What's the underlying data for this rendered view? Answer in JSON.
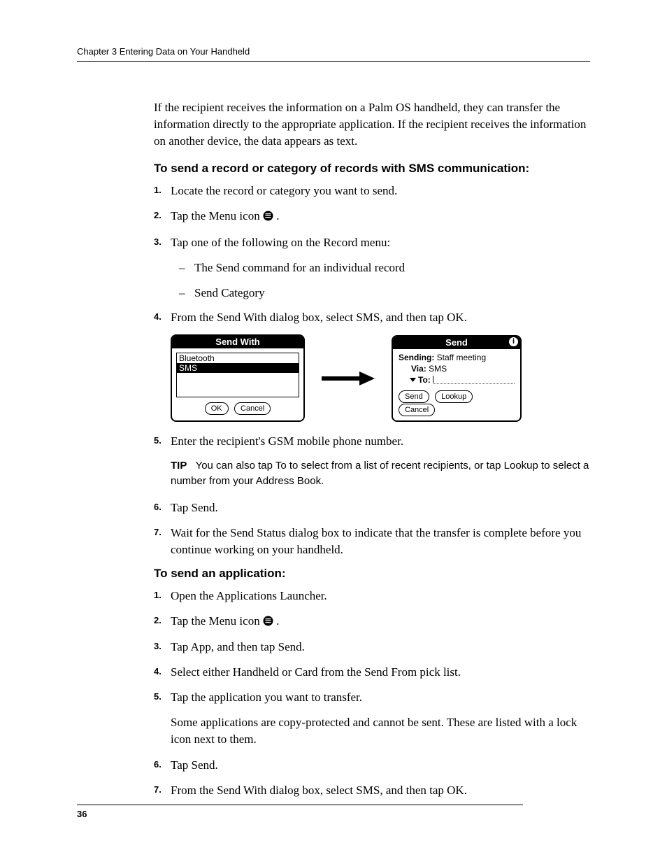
{
  "running_head": "Chapter 3   Entering Data on Your Handheld",
  "intro_para": "If the recipient receives the information on a Palm OS handheld, they can transfer the information directly to the appropriate application. If the recipient receives the information on another device, the data appears as text.",
  "section1_title": "To send a record or category of records with SMS communication:",
  "s1_steps": {
    "n1": "1.",
    "t1": "Locate the record or category you want to send.",
    "n2": "2.",
    "t2a": "Tap the Menu icon ",
    "t2b": ".",
    "n3": "3.",
    "t3": "Tap one of the following on the Record menu:",
    "sub_a": "The Send command for an individual record",
    "sub_b": "Send Category",
    "n4": "4.",
    "t4": "From the Send With dialog box, select SMS, and then tap OK.",
    "n5": "5.",
    "t5": "Enter the recipient's GSM mobile phone number.",
    "n6": "6.",
    "t6": "Tap Send.",
    "n7": "7.",
    "t7": "Wait for the Send Status dialog box to indicate that the transfer is complete before you continue working on your handheld."
  },
  "tip_label": "TIP",
  "tip_text": "You can also tap To to select from a list of recent recipients, or tap Lookup to select a number from your Address Book.",
  "figure": {
    "sendwith_title": "Send With",
    "opt_bluetooth": "Bluetooth",
    "opt_sms": "SMS",
    "btn_ok": "OK",
    "btn_cancel": "Cancel",
    "send_title": "Send",
    "sending_lbl": "Sending:",
    "sending_val": " Staff meeting",
    "via_lbl": "Via:",
    "via_val": " SMS",
    "to_lbl": "To:",
    "btn_send": "Send",
    "btn_lookup": "Lookup",
    "btn_cancel2": "Cancel",
    "info_i": "i"
  },
  "section2_title": "To send an application:",
  "s2_steps": {
    "n1": "1.",
    "t1": "Open the Applications Launcher.",
    "n2": "2.",
    "t2a": "Tap the Menu icon ",
    "t2b": ".",
    "n3": "3.",
    "t3": "Tap App, and then tap Send.",
    "n4": "4.",
    "t4": "Select either Handheld or Card from the Send From pick list.",
    "n5": "5.",
    "t5": "Tap the application you want to transfer.",
    "t5_follow": "Some applications are copy-protected and cannot be sent. These are listed with a lock icon next to them.",
    "n6": "6.",
    "t6": "Tap Send.",
    "n7": "7.",
    "t7": "From the Send With dialog box, select SMS, and then tap OK."
  },
  "page_number": "36"
}
